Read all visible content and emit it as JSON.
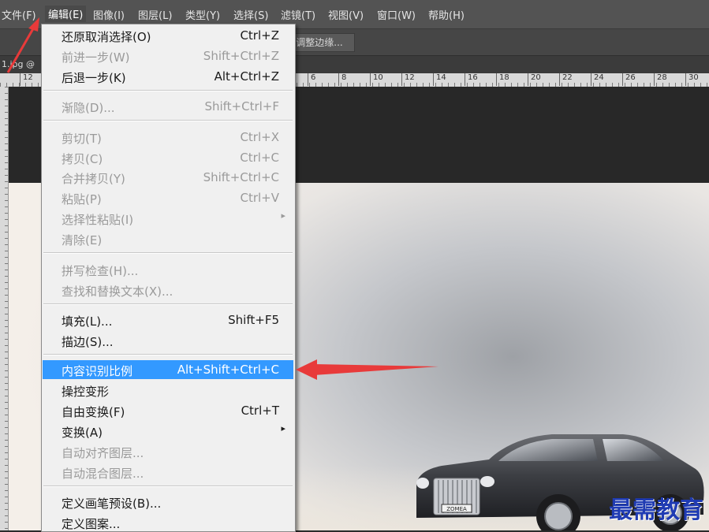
{
  "menubar": [
    "文件(F)",
    "编辑(E)",
    "图像(I)",
    "图层(L)",
    "类型(Y)",
    "选择(S)",
    "滤镜(T)",
    "视图(V)",
    "窗口(W)",
    "帮助(H)"
  ],
  "options_bar": {
    "refine_edge_label": "调整边缘..."
  },
  "document_tab": {
    "label": "1.jpg @"
  },
  "ruler": {
    "ticks": [
      "12",
      "6",
      "8",
      "10",
      "12",
      "14",
      "16",
      "18",
      "20",
      "22",
      "24",
      "26",
      "28",
      "30"
    ]
  },
  "edit_menu": {
    "items": [
      {
        "label": "还原取消选择(O)",
        "shortcut": "Ctrl+Z",
        "enabled": true
      },
      {
        "label": "前进一步(W)",
        "shortcut": "Shift+Ctrl+Z",
        "enabled": false
      },
      {
        "label": "后退一步(K)",
        "shortcut": "Alt+Ctrl+Z",
        "enabled": true
      },
      {
        "label": "渐隐(D)...",
        "shortcut": "Shift+Ctrl+F",
        "enabled": false
      },
      {
        "label": "剪切(T)",
        "shortcut": "Ctrl+X",
        "enabled": false
      },
      {
        "label": "拷贝(C)",
        "shortcut": "Ctrl+C",
        "enabled": false
      },
      {
        "label": "合并拷贝(Y)",
        "shortcut": "Shift+Ctrl+C",
        "enabled": false
      },
      {
        "label": "粘贴(P)",
        "shortcut": "Ctrl+V",
        "enabled": false
      },
      {
        "label": "选择性粘贴(I)",
        "shortcut": "",
        "enabled": false,
        "submenu": true
      },
      {
        "label": "清除(E)",
        "shortcut": "",
        "enabled": false
      },
      {
        "label": "拼写检查(H)...",
        "shortcut": "",
        "enabled": false
      },
      {
        "label": "查找和替换文本(X)...",
        "shortcut": "",
        "enabled": false
      },
      {
        "label": "填充(L)...",
        "shortcut": "Shift+F5",
        "enabled": true
      },
      {
        "label": "描边(S)...",
        "shortcut": "",
        "enabled": true
      },
      {
        "label": "内容识别比例",
        "shortcut": "Alt+Shift+Ctrl+C",
        "enabled": true,
        "highlighted": true
      },
      {
        "label": "操控变形",
        "shortcut": "",
        "enabled": true
      },
      {
        "label": "自由变换(F)",
        "shortcut": "Ctrl+T",
        "enabled": true
      },
      {
        "label": "变换(A)",
        "shortcut": "",
        "enabled": true,
        "submenu": true
      },
      {
        "label": "自动对齐图层...",
        "shortcut": "",
        "enabled": false
      },
      {
        "label": "自动混合图层...",
        "shortcut": "",
        "enabled": false
      },
      {
        "label": "定义画笔预设(B)...",
        "shortcut": "",
        "enabled": true
      },
      {
        "label": "定义图案...",
        "shortcut": "",
        "enabled": true
      }
    ],
    "submenu_glyph": "▸"
  },
  "car_badge": "ZOMEA",
  "watermark": "最需教育",
  "colors": {
    "highlight": "#3399ff",
    "annotation_arrow": "#e83a3a",
    "watermark": "#1f3bb3"
  }
}
